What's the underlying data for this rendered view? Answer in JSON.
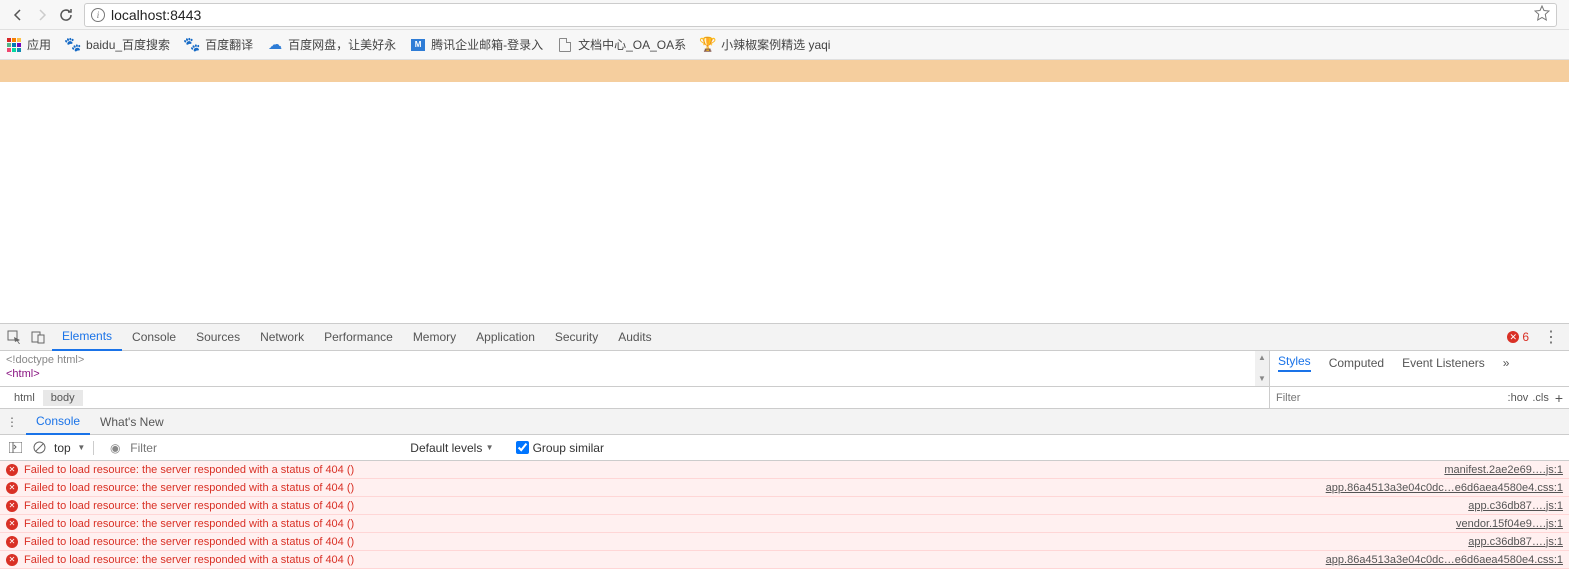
{
  "nav": {
    "url": "localhost:8443"
  },
  "bookmarks": {
    "apps": "应用",
    "items": [
      {
        "label": "baidu_百度搜索"
      },
      {
        "label": "百度翻译"
      },
      {
        "label": "百度网盘，让美好永"
      },
      {
        "label": "腾讯企业邮箱-登录入"
      },
      {
        "label": "文档中心_OA_OA系"
      },
      {
        "label": "小辣椒案例精选 yaqi"
      }
    ]
  },
  "devtools": {
    "tabs": [
      "Elements",
      "Console",
      "Sources",
      "Network",
      "Performance",
      "Memory",
      "Application",
      "Security",
      "Audits"
    ],
    "activeTab": "Elements",
    "errorCount": "6",
    "elements": {
      "doctype": "<!doctype html>",
      "html": "<html>"
    },
    "breadcrumb": [
      "html",
      "body"
    ],
    "styles": {
      "tabs": [
        "Styles",
        "Computed",
        "Event Listeners"
      ],
      "activeTab": "Styles",
      "filterPlaceholder": "Filter",
      "hov": ":hov",
      "cls": ".cls"
    },
    "drawer": {
      "tabs": [
        "Console",
        "What's New"
      ],
      "activeTab": "Console"
    },
    "console": {
      "context": "top",
      "filterPlaceholder": "Filter",
      "levels": "Default levels",
      "groupSimilar": "Group similar",
      "messages": [
        {
          "text": "Failed to load resource: the server responded with a status of 404 ()",
          "src": "manifest.2ae2e69….js:1"
        },
        {
          "text": "Failed to load resource: the server responded with a status of 404 ()",
          "src": "app.86a4513a3e04c0dc…e6d6aea4580e4.css:1"
        },
        {
          "text": "Failed to load resource: the server responded with a status of 404 ()",
          "src": "app.c36db87….js:1"
        },
        {
          "text": "Failed to load resource: the server responded with a status of 404 ()",
          "src": "vendor.15f04e9….js:1"
        },
        {
          "text": "Failed to load resource: the server responded with a status of 404 ()",
          "src": "app.c36db87….js:1"
        },
        {
          "text": "Failed to load resource: the server responded with a status of 404 ()",
          "src": "app.86a4513a3e04c0dc…e6d6aea4580e4.css:1"
        }
      ]
    }
  }
}
